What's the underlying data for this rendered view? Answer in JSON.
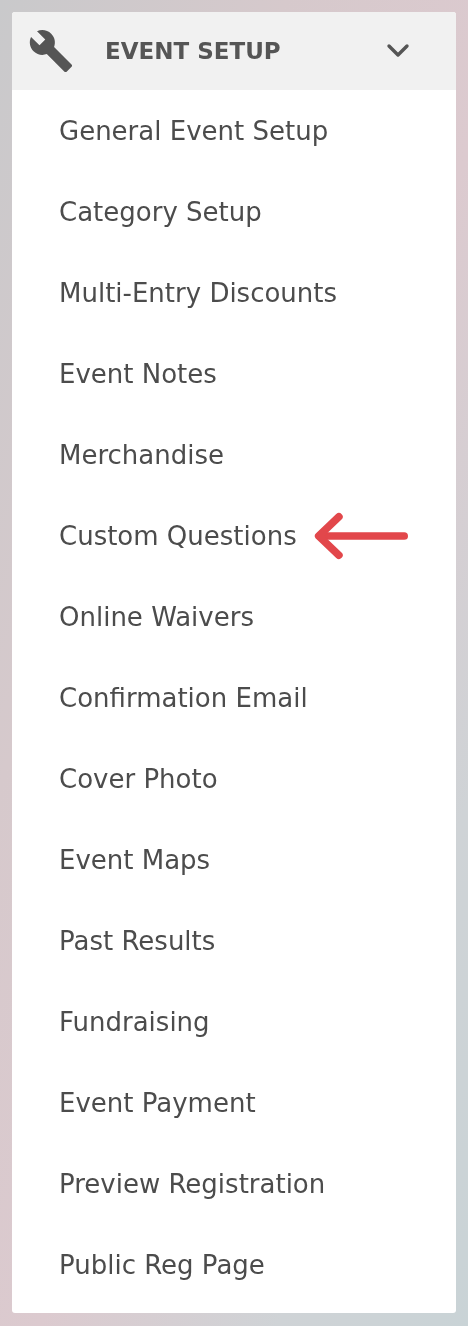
{
  "menu": {
    "title": "EVENT SETUP",
    "expanded": true,
    "items": [
      {
        "label": "General Event Setup",
        "marked": false
      },
      {
        "label": "Category Setup",
        "marked": false
      },
      {
        "label": "Multi-Entry Discounts",
        "marked": false
      },
      {
        "label": "Event Notes",
        "marked": false
      },
      {
        "label": "Merchandise",
        "marked": false
      },
      {
        "label": "Custom Questions",
        "marked": true
      },
      {
        "label": "Online Waivers",
        "marked": false
      },
      {
        "label": "Confirmation Email",
        "marked": false
      },
      {
        "label": "Cover Photo",
        "marked": false
      },
      {
        "label": "Event Maps",
        "marked": false
      },
      {
        "label": "Past Results",
        "marked": false
      },
      {
        "label": "Fundraising",
        "marked": false
      },
      {
        "label": "Event Payment",
        "marked": false
      },
      {
        "label": "Preview Registration",
        "marked": false
      },
      {
        "label": "Public Reg Page",
        "marked": false
      }
    ]
  }
}
